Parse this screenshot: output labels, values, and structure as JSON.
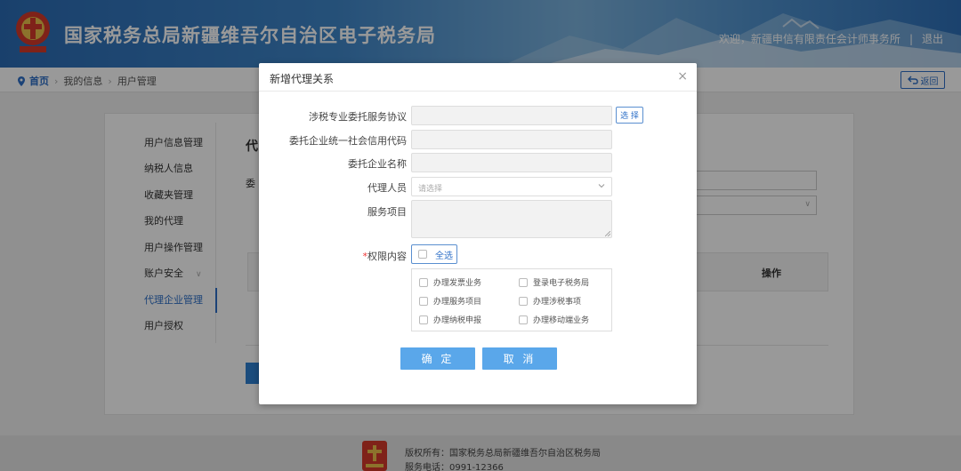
{
  "header": {
    "site_title": "国家税务总局新疆维吾尔自治区电子税务局",
    "welcome": "欢迎，新疆申信有限责任会计师事务所",
    "logout": "退出",
    "colors": {
      "primary": "#2d6fc7",
      "accent_button": "#5aa7ea"
    }
  },
  "breadcrumb": {
    "home": "首页",
    "items": [
      "我的信息",
      "用户管理"
    ],
    "back_label": "返回"
  },
  "sidebar": {
    "items": [
      {
        "label": "用户信息管理"
      },
      {
        "label": "纳税人信息"
      },
      {
        "label": "收藏夹管理"
      },
      {
        "label": "我的代理"
      },
      {
        "label": "用户操作管理"
      },
      {
        "label": "账户安全"
      },
      {
        "label": "代理企业管理",
        "active": true
      },
      {
        "label": "用户授权"
      }
    ]
  },
  "background": {
    "heading": "代",
    "label": "委",
    "table_col_first": "",
    "table_col_op": "操作"
  },
  "footer": {
    "copyright": "版权所有：国家税务总局新疆维吾尔自治区税务局",
    "phone": "服务电话：0991-12366"
  },
  "modal": {
    "title": "新增代理关系",
    "close": "×",
    "fields": {
      "agreement_label": "涉税专业委托服务协议",
      "choose_button": "选 择",
      "credit_code_label": "委托企业统一社会信用代码",
      "company_name_label": "委托企业名称",
      "agent_label": "代理人员",
      "agent_placeholder": "请选择",
      "service_label": "服务项目",
      "permission_required": "*",
      "permission_label": "权限内容"
    },
    "select_all": "全选",
    "permissions": [
      "办理发票业务",
      "登录电子税务局",
      "办理服务项目",
      "办理涉税事项",
      "办理纳税申报",
      "办理移动端业务"
    ],
    "confirm": "确 定",
    "cancel": "取 消"
  }
}
